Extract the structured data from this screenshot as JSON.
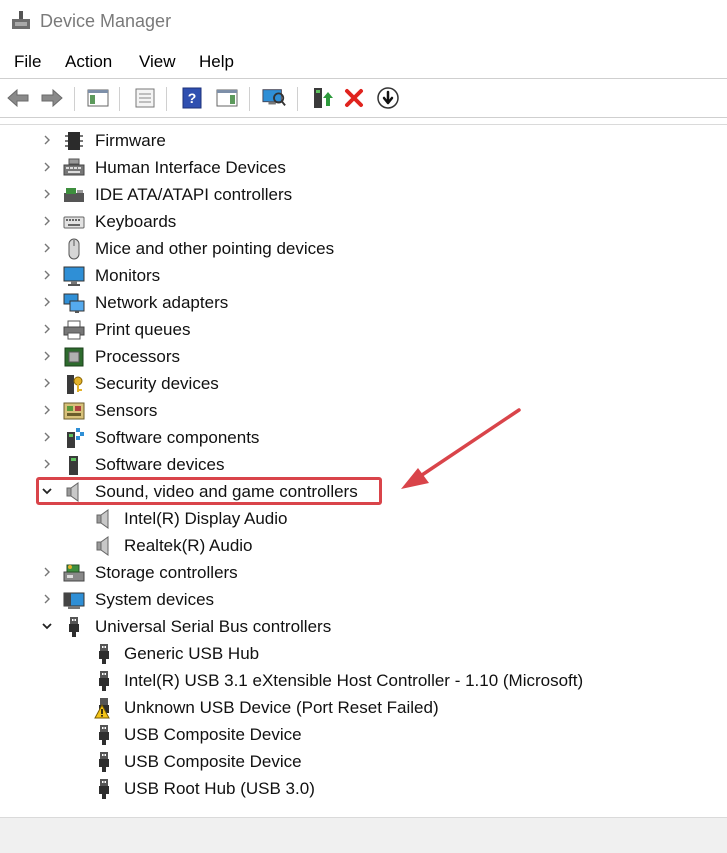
{
  "window": {
    "title": "Device Manager"
  },
  "menu": [
    "File",
    "Action",
    "View",
    "Help"
  ],
  "toolbar": [
    "back-icon",
    "forward-icon",
    "show-hide-console-tree-icon",
    "properties-icon",
    "help-icon",
    "action-pane-icon",
    "scan-hardware-icon",
    "update-driver-icon",
    "uninstall-device-icon",
    "disable-device-icon"
  ],
  "tree": [
    {
      "label": "Firmware",
      "level": 0,
      "expanded": false,
      "icon": "firmware-chip-icon"
    },
    {
      "label": "Human Interface Devices",
      "level": 0,
      "expanded": false,
      "icon": "hid-keyboard-icon"
    },
    {
      "label": "IDE ATA/ATAPI controllers",
      "level": 0,
      "expanded": false,
      "icon": "ide-controller-icon"
    },
    {
      "label": "Keyboards",
      "level": 0,
      "expanded": false,
      "icon": "keyboard-icon"
    },
    {
      "label": "Mice and other pointing devices",
      "level": 0,
      "expanded": false,
      "icon": "mouse-icon"
    },
    {
      "label": "Monitors",
      "level": 0,
      "expanded": false,
      "icon": "monitor-icon"
    },
    {
      "label": "Network adapters",
      "level": 0,
      "expanded": false,
      "icon": "network-adapter-icon"
    },
    {
      "label": "Print queues",
      "level": 0,
      "expanded": false,
      "icon": "printer-icon"
    },
    {
      "label": "Processors",
      "level": 0,
      "expanded": false,
      "icon": "processor-icon"
    },
    {
      "label": "Security devices",
      "level": 0,
      "expanded": false,
      "icon": "security-device-icon"
    },
    {
      "label": "Sensors",
      "level": 0,
      "expanded": false,
      "icon": "sensor-icon"
    },
    {
      "label": "Software components",
      "level": 0,
      "expanded": false,
      "icon": "software-component-icon"
    },
    {
      "label": "Software devices",
      "level": 0,
      "expanded": false,
      "icon": "software-device-icon"
    },
    {
      "label": "Sound, video and game controllers",
      "level": 0,
      "expanded": true,
      "icon": "speaker-icon",
      "highlighted": true
    },
    {
      "label": "Intel(R) Display Audio",
      "level": 1,
      "icon": "speaker-icon"
    },
    {
      "label": "Realtek(R) Audio",
      "level": 1,
      "icon": "speaker-icon"
    },
    {
      "label": "Storage controllers",
      "level": 0,
      "expanded": false,
      "icon": "storage-controller-icon"
    },
    {
      "label": "System devices",
      "level": 0,
      "expanded": false,
      "icon": "system-device-icon"
    },
    {
      "label": "Universal Serial Bus controllers",
      "level": 0,
      "expanded": true,
      "icon": "usb-plug-icon"
    },
    {
      "label": "Generic USB Hub",
      "level": 1,
      "icon": "usb-plug-icon"
    },
    {
      "label": "Intel(R) USB 3.1 eXtensible Host Controller - 1.10 (Microsoft)",
      "level": 1,
      "icon": "usb-plug-icon"
    },
    {
      "label": "Unknown USB Device (Port Reset Failed)",
      "level": 1,
      "icon": "usb-warning-icon"
    },
    {
      "label": "USB Composite Device",
      "level": 1,
      "icon": "usb-plug-icon"
    },
    {
      "label": "USB Composite Device",
      "level": 1,
      "icon": "usb-plug-icon"
    },
    {
      "label": "USB Root Hub (USB 3.0)",
      "level": 1,
      "icon": "usb-plug-icon"
    }
  ],
  "colors": {
    "highlight": "#d9444a",
    "arrow": "#d9444a"
  }
}
